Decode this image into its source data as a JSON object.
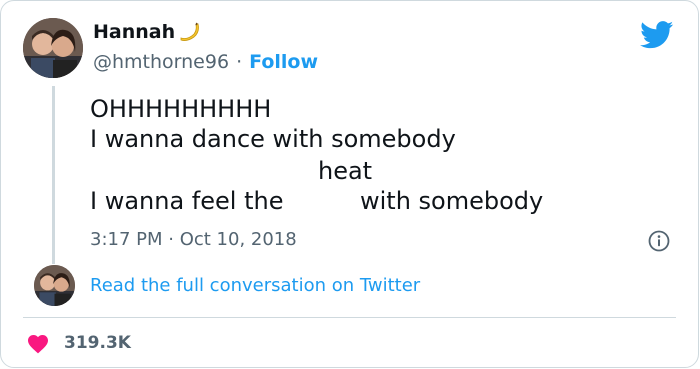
{
  "user": {
    "display_name": "Hannah",
    "emoji": "banana",
    "handle": "@hmthorne96",
    "separator": "·",
    "follow_label": "Follow"
  },
  "tweet": {
    "lines": [
      "OHHHHHHHHH",
      "I wanna dance with somebody",
      "heat",
      "I wanna feel the",
      "with somebody"
    ],
    "timestamp": "3:17 PM · Oct 10, 2018"
  },
  "footer": {
    "read_link": "Read the full conversation on Twitter",
    "like_count": "319.3K"
  },
  "colors": {
    "brand": "#1d9bf0",
    "like": "#f91880",
    "text": "#0f1419",
    "muted": "#536471",
    "border": "#cfd9de"
  },
  "icons": [
    "twitter-bird-icon",
    "info-icon",
    "heart-icon",
    "banana-icon"
  ]
}
